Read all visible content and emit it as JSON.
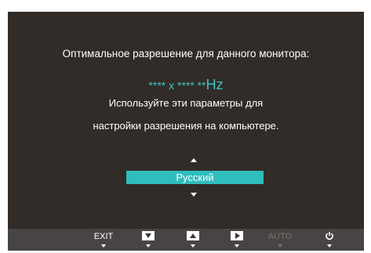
{
  "osd": {
    "title": "Оптимальное разрешение для данного монитора:",
    "resolution_value": "**** x **** **",
    "resolution_unit": "Hz",
    "hint_line1": "Используйте эти параметры для",
    "hint_line2": "настройки разрешения на компьютере.",
    "language_selected": "Русский"
  },
  "button_bar": {
    "exit_label": "EXIT",
    "auto_label": "AUTO",
    "auto_enabled": false
  },
  "colors": {
    "background": "#312c28",
    "accent": "#2fbdbd",
    "bar": "#484443"
  },
  "icons": {
    "down": "down-arrow-icon",
    "up": "up-arrow-icon",
    "right": "right-arrow-icon",
    "power": "power-icon"
  }
}
